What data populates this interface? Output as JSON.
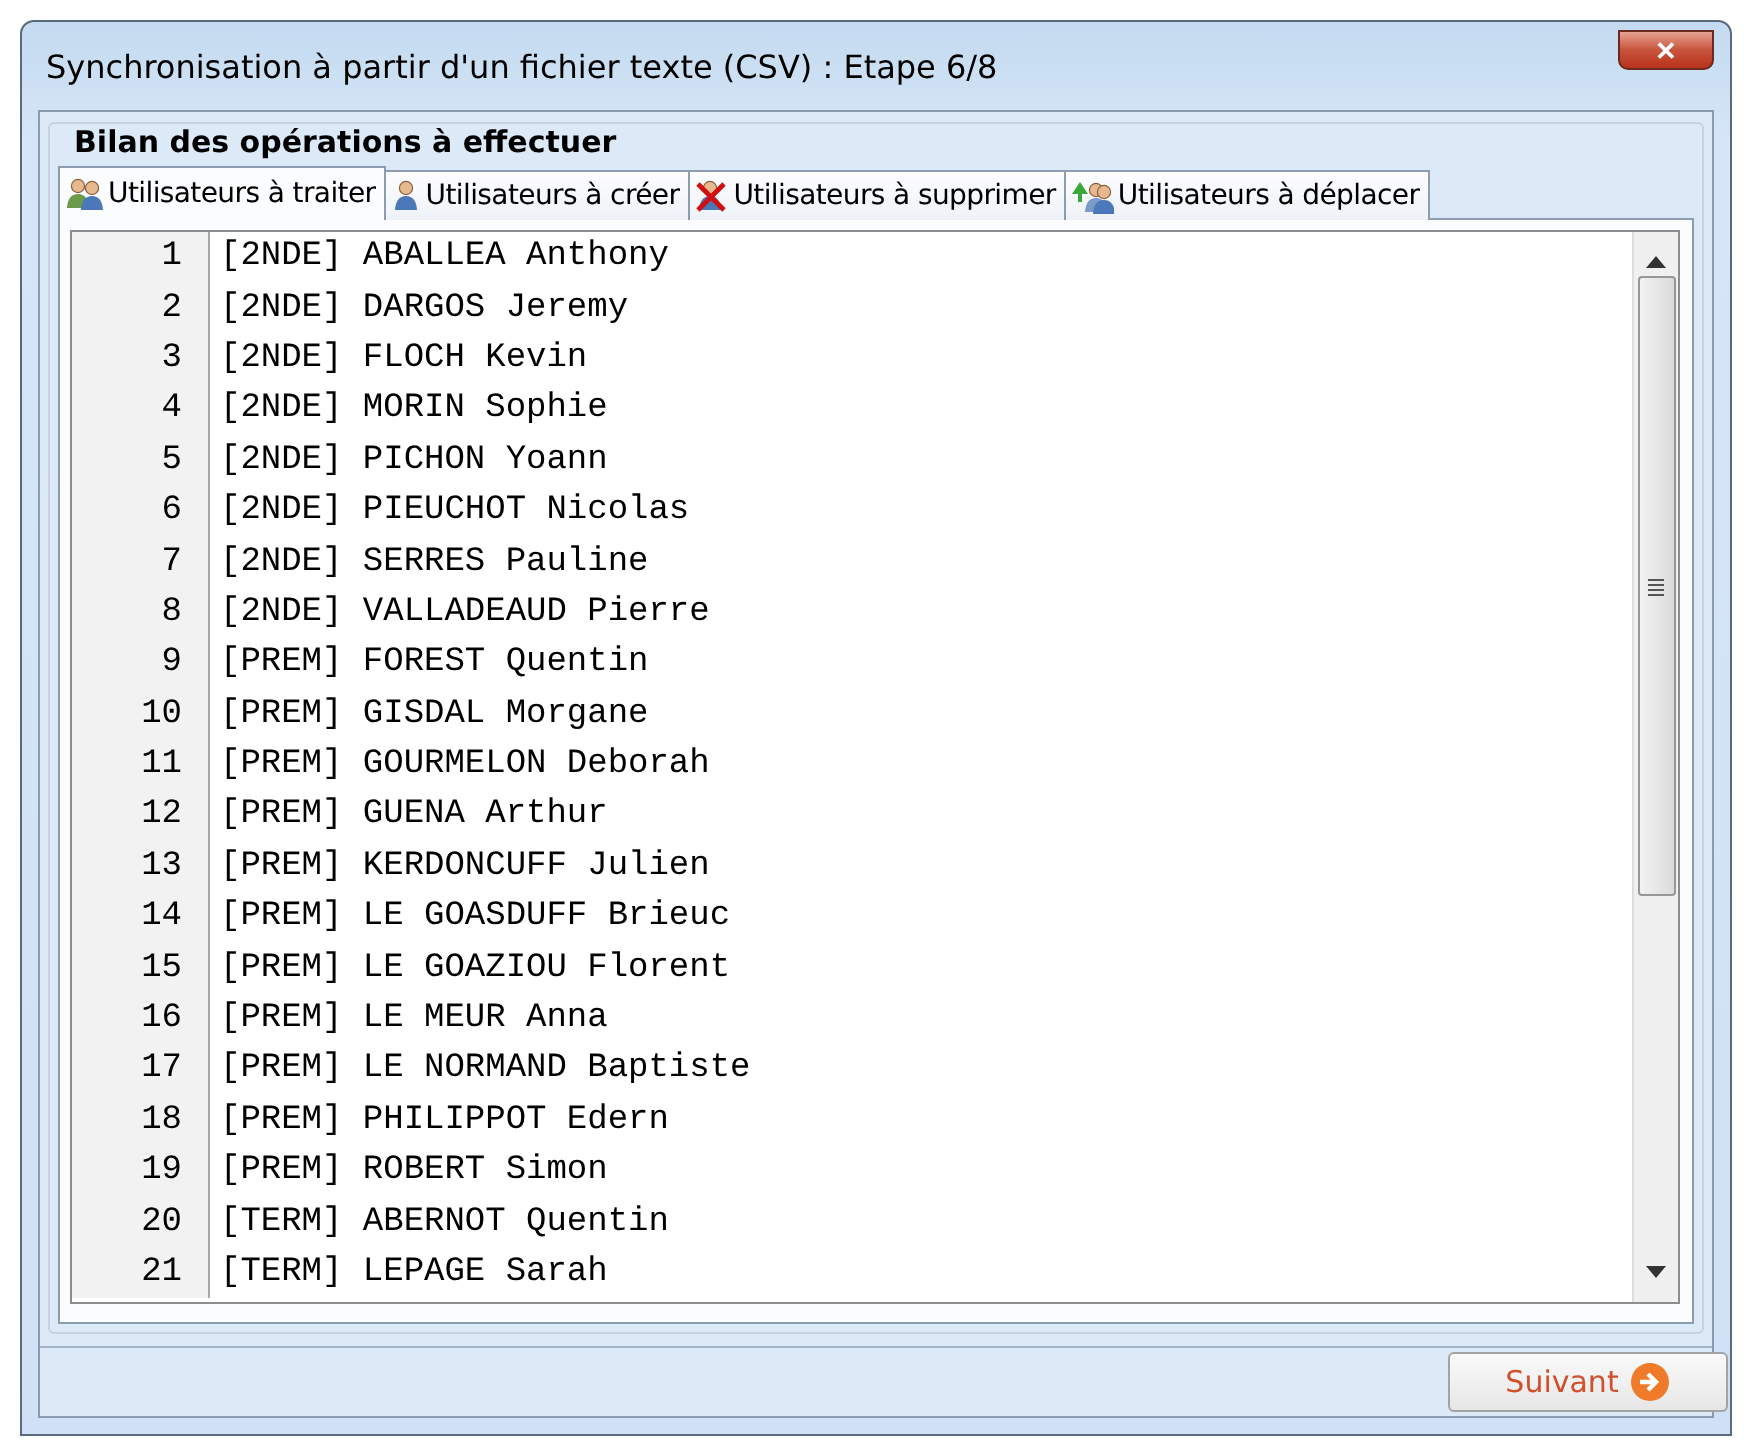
{
  "window": {
    "title": "Synchronisation à partir d'un fichier texte (CSV) : Etape 6/8",
    "close": "✕"
  },
  "group": {
    "title": "Bilan des opérations à effectuer"
  },
  "tabs": [
    {
      "label": "Utilisateurs à traiter",
      "selected": true,
      "kind": "users"
    },
    {
      "label": "Utilisateurs à créer",
      "selected": false,
      "kind": "user"
    },
    {
      "label": "Utilisateurs à supprimer",
      "selected": false,
      "kind": "delete"
    },
    {
      "label": "Utilisateurs à déplacer",
      "selected": false,
      "kind": "move"
    }
  ],
  "lines": [
    {
      "number": "1",
      "text": "[2NDE] ABALLEA Anthony"
    },
    {
      "number": "2",
      "text": "[2NDE] DARGOS Jeremy"
    },
    {
      "number": "3",
      "text": "[2NDE] FLOCH Kevin"
    },
    {
      "number": "4",
      "text": "[2NDE] MORIN Sophie"
    },
    {
      "number": "5",
      "text": "[2NDE] PICHON Yoann"
    },
    {
      "number": "6",
      "text": "[2NDE] PIEUCHOT Nicolas"
    },
    {
      "number": "7",
      "text": "[2NDE] SERRES Pauline"
    },
    {
      "number": "8",
      "text": "[2NDE] VALLADEAUD Pierre"
    },
    {
      "number": "9",
      "text": "[PREM] FOREST Quentin"
    },
    {
      "number": "10",
      "text": "[PREM] GISDAL Morgane"
    },
    {
      "number": "11",
      "text": "[PREM] GOURMELON Deborah"
    },
    {
      "number": "12",
      "text": "[PREM] GUENA Arthur"
    },
    {
      "number": "13",
      "text": "[PREM] KERDONCUFF Julien"
    },
    {
      "number": "14",
      "text": "[PREM] LE GOASDUFF Brieuc"
    },
    {
      "number": "15",
      "text": "[PREM] LE GOAZIOU Florent"
    },
    {
      "number": "16",
      "text": "[PREM] LE MEUR Anna"
    },
    {
      "number": "17",
      "text": "[PREM] LE NORMAND Baptiste"
    },
    {
      "number": "18",
      "text": "[PREM] PHILIPPOT Edern"
    },
    {
      "number": "19",
      "text": "[PREM] ROBERT Simon"
    },
    {
      "number": "20",
      "text": "[TERM] ABERNOT Quentin"
    },
    {
      "number": "21",
      "text": "[TERM] LEPAGE Sarah"
    }
  ],
  "next_button": {
    "label": "Suivant"
  }
}
